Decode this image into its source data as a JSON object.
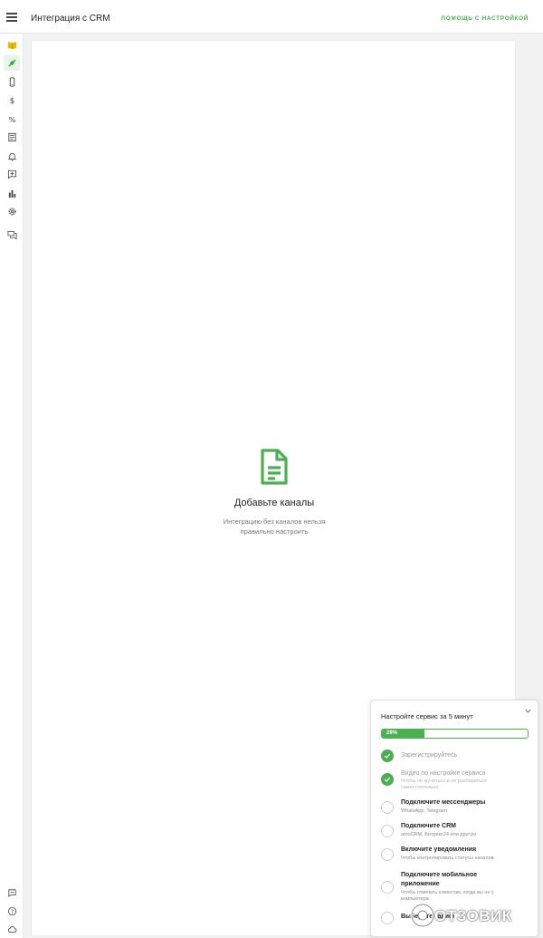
{
  "header": {
    "title": "Интеграция с CRM",
    "help_label": "помощь с настройкой"
  },
  "sidebar": {
    "items": [
      {
        "icon": "book-icon",
        "active": false
      },
      {
        "icon": "plug-icon",
        "active": true
      },
      {
        "icon": "phone-icon",
        "active": false
      },
      {
        "icon": "dollar-icon",
        "active": false
      },
      {
        "icon": "percent-icon",
        "active": false
      },
      {
        "icon": "document-icon",
        "active": false
      },
      {
        "icon": "bell-icon",
        "active": false
      },
      {
        "icon": "chat-add-icon",
        "active": false
      },
      {
        "icon": "bar-chart-icon",
        "active": false
      },
      {
        "icon": "gear-icon",
        "active": false
      },
      {
        "icon": "messages-icon",
        "active": false
      }
    ],
    "bottom_items": [
      {
        "icon": "chat-icon"
      },
      {
        "icon": "help-icon"
      },
      {
        "icon": "cloud-icon"
      }
    ]
  },
  "empty_state": {
    "title": "Добавьте каналы",
    "description": "Интеграцию без каналов нельзя правильно настроить"
  },
  "onboarding": {
    "title": "Настройте сервис за 5 минут",
    "progress_label": "29%",
    "progress": 0.29,
    "steps": [
      {
        "title": "Зарегистрируйтесь",
        "subtitle": "",
        "done": true
      },
      {
        "title": "Видео по настройке сервиса",
        "subtitle": "Чтобы не мучиться и не разбираться самостоятельно",
        "done": true
      },
      {
        "title": "Подключите мессенджеры",
        "subtitle": "WhatsApp, Telegram",
        "done": false
      },
      {
        "title": "Подключите CRM",
        "subtitle": "amoCRM, Битрикс24 или другую",
        "done": false
      },
      {
        "title": "Включите уведомления",
        "subtitle": "Чтобы контролировать статусы каналов",
        "done": false
      },
      {
        "title": "Подключите мобильное приложение",
        "subtitle": "Чтобы отвечать клиентам, когда вы не у компьютера",
        "done": false
      },
      {
        "title": "Выберите тариф",
        "subtitle": "",
        "done": false
      }
    ]
  },
  "watermark": {
    "text": "ОТЗОВИК"
  },
  "colors": {
    "accent": "#4caf50",
    "book_icon": "#e6b800"
  }
}
